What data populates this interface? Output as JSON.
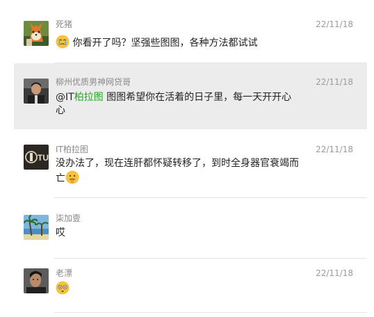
{
  "comments": [
    {
      "name": "死猪",
      "time": "22/11/18",
      "text": "你看开了吗？坚强些图图，各种方法都试试",
      "avatar": "fox-cartoon-avatar",
      "emoji": "crying-face-emoji"
    },
    {
      "name": "柳州优质男神网贷哥",
      "time": "22/11/18",
      "mention_prefix": "@IT",
      "mention_link": "柏拉图",
      "text": " 图图希望你在活着的日子里，每一天开开心心",
      "avatar": "man-photo-avatar"
    },
    {
      "name": "IT柏拉图",
      "time": "22/11/18",
      "text": "没办法了，现在连肝都怀疑转移了，到时全身器官衰竭而亡",
      "avatar": "itu-logo-avatar",
      "emoji": "shushing-face-emoji"
    },
    {
      "name": "柒加壹",
      "time": "",
      "text": "哎",
      "avatar": "palm-beach-avatar"
    },
    {
      "name": "老漂",
      "time": "22/11/18",
      "text": "",
      "avatar": "man-portrait-avatar",
      "emoji": "flushed-face-emoji"
    }
  ],
  "colors": {
    "highlight": "#ececec",
    "link": "#1aad19",
    "name": "#8a8a8a",
    "text": "#222222"
  }
}
